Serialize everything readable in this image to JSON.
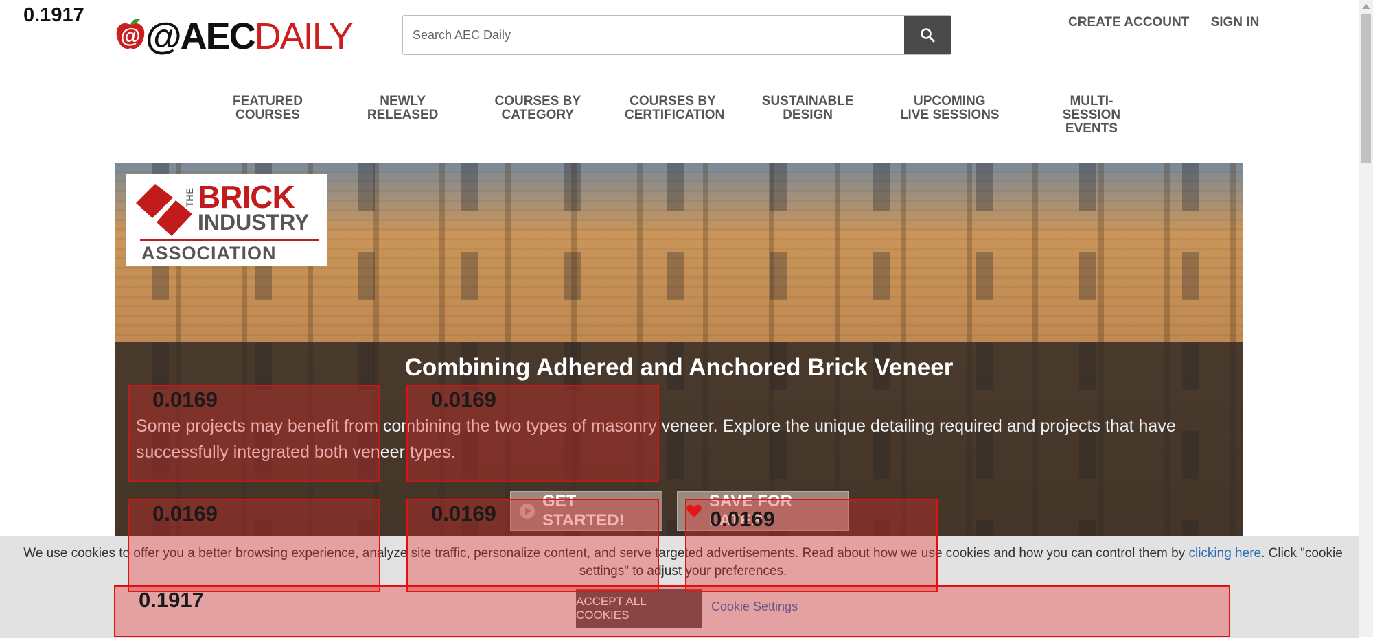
{
  "annotation_score_top": "0.1917",
  "header": {
    "logo_aec": "@AEC",
    "logo_daily": "DAILY",
    "search_placeholder": "Search AEC Daily",
    "create_account": "CREATE ACCOUNT",
    "sign_in": "SIGN IN"
  },
  "nav": [
    {
      "line1": "FEATURED",
      "line2": "COURSES"
    },
    {
      "line1": "NEWLY",
      "line2": "RELEASED"
    },
    {
      "line1": "COURSES BY",
      "line2": "CATEGORY"
    },
    {
      "line1": "COURSES BY",
      "line2": "CERTIFICATION"
    },
    {
      "line1": "SUSTAINABLE",
      "line2": "DESIGN"
    },
    {
      "line1": "UPCOMING",
      "line2": "LIVE SESSIONS"
    },
    {
      "line1": "MULTI-SESSION",
      "line2": "EVENTS"
    }
  ],
  "hero": {
    "brand_the": "THE",
    "brand_brick": "BRICK",
    "brand_industry": "INDUSTRY",
    "brand_association": "ASSOCIATION",
    "title": "Combining Adhered and Anchored Brick Veneer",
    "description": "Some projects may benefit from combining the two types of masonry veneer. Explore the unique detailing required and projects that have successfully integrated both veneer types.",
    "get_started": "GET STARTED!",
    "save_for_later": "SAVE FOR LATER"
  },
  "cookie": {
    "icon": "",
    "text_before": "We use cookies to offer you a better browsing experience, analyze site traffic, personalize content, and serve targeted advertisements. Read about how we use cookies and how you can control them by ",
    "link": "clicking here",
    "text_after": ". Click \"cookie settings\" to adjust your preferences.",
    "accept": "ACCEPT ALL COOKIES",
    "settings": "Cookie Settings"
  },
  "annotations": [
    {
      "score": "0.0169"
    },
    {
      "score": "0.0169"
    },
    {
      "score": "0.0169"
    },
    {
      "score": "0.0169"
    },
    {
      "score": "0.0169"
    },
    {
      "score": "0.1917"
    }
  ],
  "colors": {
    "brand_red": "#cc1f1f",
    "link_blue": "#2a6db5",
    "annotation_red": "#e01010"
  }
}
